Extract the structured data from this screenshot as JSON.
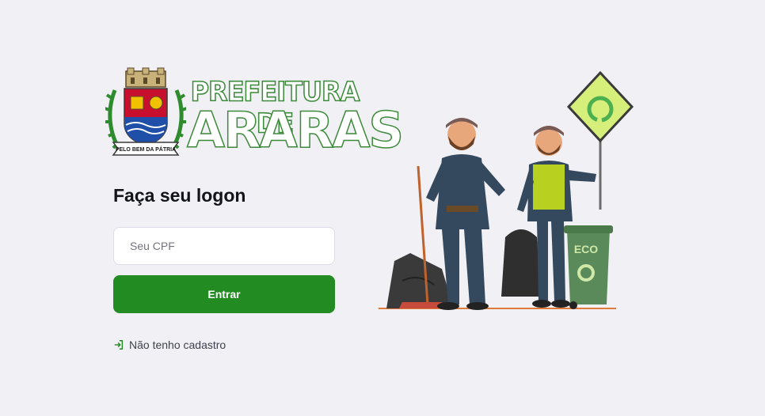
{
  "logo": {
    "line1": "PREFEITURA DE",
    "line2": "ARARAS",
    "motto": "PELO BEM DA PÁTRIA"
  },
  "form": {
    "title": "Faça seu logon",
    "cpf_placeholder": "Seu CPF",
    "submit_label": "Entrar",
    "register_label": "Não tenho cadastro"
  },
  "illustration": {
    "bin_label": "ECO"
  },
  "colors": {
    "background": "#f0f0f5",
    "primary": "#228b22",
    "text": "#13131a",
    "muted": "#41414d",
    "logo_green": "#3d8a3b"
  },
  "icons": {
    "register": "log-in-icon",
    "sign": "recycle-icon"
  }
}
